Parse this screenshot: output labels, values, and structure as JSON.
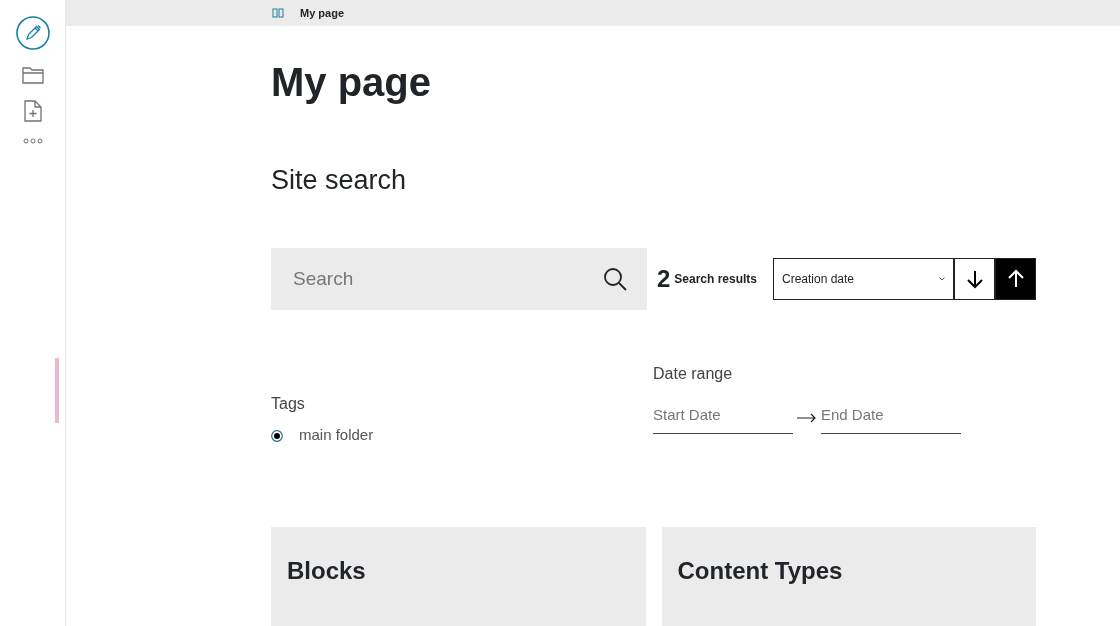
{
  "breadcrumb": {
    "current": "My page"
  },
  "page_title": "My page",
  "section_title": "Site search",
  "search": {
    "placeholder": "Search"
  },
  "results": {
    "count": "2",
    "label": "Search results"
  },
  "sort": {
    "value": "Creation date",
    "directions": [
      {
        "kind": "descending",
        "selected": false
      },
      {
        "kind": "ascending",
        "selected": true
      }
    ]
  },
  "tags": {
    "label": "Tags",
    "options": [
      {
        "label": "main folder",
        "selected": true
      }
    ]
  },
  "date_range": {
    "label": "Date range",
    "start_placeholder": "Start Date",
    "end_placeholder": "End Date"
  },
  "cards": [
    {
      "title": "Blocks"
    },
    {
      "title": "Content Types"
    }
  ]
}
